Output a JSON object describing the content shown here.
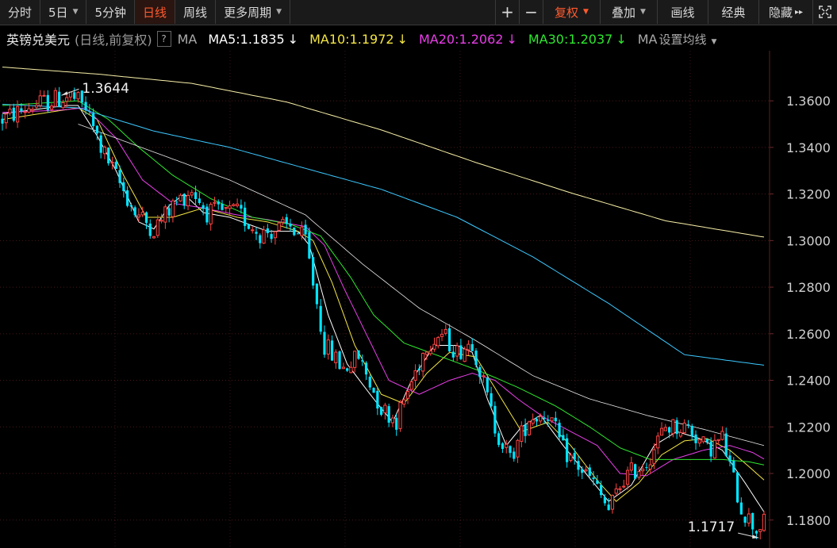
{
  "toolbar": {
    "tabs": [
      {
        "label": "分时",
        "dropdown": false,
        "active": false
      },
      {
        "label": "5日",
        "dropdown": true,
        "active": false
      },
      {
        "label": "5分钟",
        "dropdown": false,
        "active": false
      },
      {
        "label": "日线",
        "dropdown": false,
        "active": true
      },
      {
        "label": "周线",
        "dropdown": false,
        "active": false
      },
      {
        "label": "更多周期",
        "dropdown": true,
        "active": false
      }
    ],
    "zoom_in": "+",
    "zoom_out": "−",
    "fuquan": "复权",
    "diejia": "叠加",
    "huaxian": "画线",
    "jingdian": "经典",
    "yincang": "隐藏",
    "dropdown_glyph": "▼",
    "more_glyph": "▸▸"
  },
  "info": {
    "title": "英镑兑美元",
    "subtitle": "(日线,前复权)",
    "help": "?",
    "ma_label": "MA",
    "ma_items": [
      {
        "text": "MA5:1.1835",
        "arrow": "↓",
        "color": "#ffffff"
      },
      {
        "text": "MA10:1.1972",
        "arrow": "↓",
        "color": "#f5e642"
      },
      {
        "text": "MA20:1.2062",
        "arrow": "↓",
        "color": "#e83ee8"
      },
      {
        "text": "MA30:1.2037",
        "arrow": "↓",
        "color": "#2ee82e"
      }
    ],
    "ma_more": "MA",
    "settings": "设置均线"
  },
  "chart_data": {
    "type": "candlestick",
    "y_ticks": [
      "1.3600",
      "1.3400",
      "1.3200",
      "1.3000",
      "1.2800",
      "1.2600",
      "1.2400",
      "1.2200",
      "1.2000",
      "1.1800"
    ],
    "ylim": [
      1.168,
      1.3815
    ],
    "high_annotation": "1.3644",
    "low_annotation": "1.1717",
    "up_color": "#ff4444",
    "down_color": "#00e5ff",
    "anchors": [
      [
        0,
        1.352
      ],
      [
        8,
        1.358
      ],
      [
        18,
        1.362
      ],
      [
        22,
        1.357
      ],
      [
        26,
        1.34
      ],
      [
        35,
        1.312
      ],
      [
        40,
        1.305
      ],
      [
        45,
        1.315
      ],
      [
        50,
        1.322
      ],
      [
        54,
        1.312
      ],
      [
        62,
        1.312
      ],
      [
        68,
        1.303
      ],
      [
        76,
        1.306
      ],
      [
        80,
        1.3
      ],
      [
        85,
        1.255
      ],
      [
        90,
        1.245
      ],
      [
        94,
        1.25
      ],
      [
        100,
        1.228
      ],
      [
        104,
        1.223
      ],
      [
        112,
        1.256
      ],
      [
        116,
        1.26
      ],
      [
        120,
        1.252
      ],
      [
        124,
        1.257
      ],
      [
        130,
        1.22
      ],
      [
        134,
        1.206
      ],
      [
        139,
        1.224
      ],
      [
        144,
        1.226
      ],
      [
        148,
        1.21
      ],
      [
        156,
        1.196
      ],
      [
        160,
        1.184
      ],
      [
        164,
        1.198
      ],
      [
        170,
        1.205
      ],
      [
        175,
        1.22
      ],
      [
        181,
        1.22
      ],
      [
        186,
        1.21
      ],
      [
        190,
        1.215
      ],
      [
        195,
        1.185
      ],
      [
        199,
        1.176
      ],
      [
        201,
        1.18
      ]
    ],
    "ma_lines": [
      {
        "name": "MA5",
        "color": "#ffffff",
        "width": 1.0,
        "points": [
          [
            0,
            1.3545
          ],
          [
            17,
            1.358
          ],
          [
            20,
            1.358
          ],
          [
            25,
            1.345
          ],
          [
            30,
            1.33
          ],
          [
            36,
            1.308
          ],
          [
            40,
            1.305
          ],
          [
            44,
            1.315
          ],
          [
            48,
            1.32
          ],
          [
            53,
            1.312
          ],
          [
            60,
            1.31
          ],
          [
            70,
            1.304
          ],
          [
            78,
            1.304
          ],
          [
            81,
            1.298
          ],
          [
            86,
            1.268
          ],
          [
            91,
            1.247
          ],
          [
            98,
            1.232
          ],
          [
            103,
            1.222
          ],
          [
            108,
            1.24
          ],
          [
            114,
            1.255
          ],
          [
            120,
            1.255
          ],
          [
            124,
            1.252
          ],
          [
            128,
            1.232
          ],
          [
            133,
            1.212
          ],
          [
            137,
            1.22
          ],
          [
            142,
            1.225
          ],
          [
            148,
            1.212
          ],
          [
            154,
            1.2
          ],
          [
            160,
            1.188
          ],
          [
            166,
            1.195
          ],
          [
            172,
            1.212
          ],
          [
            178,
            1.218
          ],
          [
            184,
            1.215
          ],
          [
            190,
            1.21
          ],
          [
            196,
            1.196
          ],
          [
            201,
            1.1835
          ]
        ]
      },
      {
        "name": "MA10",
        "color": "#f5e642",
        "width": 1.0,
        "points": [
          [
            0,
            1.352
          ],
          [
            12,
            1.355
          ],
          [
            20,
            1.357
          ],
          [
            25,
            1.352
          ],
          [
            32,
            1.328
          ],
          [
            38,
            1.31
          ],
          [
            45,
            1.31
          ],
          [
            53,
            1.314
          ],
          [
            62,
            1.31
          ],
          [
            70,
            1.308
          ],
          [
            78,
            1.304
          ],
          [
            82,
            1.3
          ],
          [
            87,
            1.282
          ],
          [
            93,
            1.255
          ],
          [
            100,
            1.234
          ],
          [
            106,
            1.23
          ],
          [
            112,
            1.243
          ],
          [
            118,
            1.252
          ],
          [
            125,
            1.25
          ],
          [
            131,
            1.234
          ],
          [
            137,
            1.218
          ],
          [
            144,
            1.222
          ],
          [
            150,
            1.212
          ],
          [
            157,
            1.197
          ],
          [
            162,
            1.188
          ],
          [
            168,
            1.196
          ],
          [
            174,
            1.208
          ],
          [
            180,
            1.214
          ],
          [
            186,
            1.215
          ],
          [
            192,
            1.21
          ],
          [
            197,
            1.203
          ],
          [
            201,
            1.1972
          ]
        ]
      },
      {
        "name": "MA20",
        "color": "#e83ee8",
        "width": 1.0,
        "points": [
          [
            0,
            1.355
          ],
          [
            15,
            1.356
          ],
          [
            22,
            1.357
          ],
          [
            30,
            1.344
          ],
          [
            37,
            1.326
          ],
          [
            45,
            1.316
          ],
          [
            53,
            1.314
          ],
          [
            62,
            1.311
          ],
          [
            70,
            1.309
          ],
          [
            80,
            1.306
          ],
          [
            85,
            1.298
          ],
          [
            90,
            1.28
          ],
          [
            96,
            1.26
          ],
          [
            102,
            1.24
          ],
          [
            110,
            1.234
          ],
          [
            118,
            1.24
          ],
          [
            124,
            1.243
          ],
          [
            130,
            1.24
          ],
          [
            136,
            1.232
          ],
          [
            143,
            1.224
          ],
          [
            150,
            1.218
          ],
          [
            157,
            1.212
          ],
          [
            163,
            1.2
          ],
          [
            170,
            1.199
          ],
          [
            177,
            1.206
          ],
          [
            185,
            1.21
          ],
          [
            192,
            1.212
          ],
          [
            198,
            1.209
          ],
          [
            201,
            1.2062
          ]
        ]
      },
      {
        "name": "MA30",
        "color": "#2ee82e",
        "width": 1.0,
        "points": [
          [
            0,
            1.358
          ],
          [
            20,
            1.36
          ],
          [
            28,
            1.352
          ],
          [
            36,
            1.34
          ],
          [
            45,
            1.328
          ],
          [
            55,
            1.318
          ],
          [
            66,
            1.31
          ],
          [
            76,
            1.307
          ],
          [
            84,
            1.302
          ],
          [
            92,
            1.284
          ],
          [
            98,
            1.268
          ],
          [
            106,
            1.256
          ],
          [
            116,
            1.25
          ],
          [
            126,
            1.244
          ],
          [
            136,
            1.237
          ],
          [
            146,
            1.229
          ],
          [
            155,
            1.22
          ],
          [
            163,
            1.211
          ],
          [
            171,
            1.206
          ],
          [
            180,
            1.206
          ],
          [
            190,
            1.206
          ],
          [
            197,
            1.205
          ],
          [
            201,
            1.2037
          ]
        ]
      },
      {
        "name": "MA60",
        "color": "#e8e8e8",
        "width": 0.8,
        "points": [
          [
            20,
            1.35
          ],
          [
            40,
            1.338
          ],
          [
            60,
            1.326
          ],
          [
            80,
            1.311
          ],
          [
            95,
            1.29
          ],
          [
            110,
            1.271
          ],
          [
            125,
            1.257
          ],
          [
            140,
            1.242
          ],
          [
            155,
            1.232
          ],
          [
            170,
            1.225
          ],
          [
            185,
            1.219
          ],
          [
            201,
            1.212
          ]
        ]
      },
      {
        "name": "MA120",
        "color": "#3cc8ff",
        "width": 1.0,
        "points": [
          [
            0,
            1.3585
          ],
          [
            20,
            1.357
          ],
          [
            40,
            1.347
          ],
          [
            60,
            1.34
          ],
          [
            80,
            1.331
          ],
          [
            100,
            1.322
          ],
          [
            120,
            1.31
          ],
          [
            140,
            1.293
          ],
          [
            160,
            1.273
          ],
          [
            180,
            1.251
          ],
          [
            201,
            1.2465
          ]
        ]
      },
      {
        "name": "MA250",
        "color": "#f8f0a8",
        "width": 1.0,
        "points": [
          [
            0,
            1.3745
          ],
          [
            25,
            1.3715
          ],
          [
            50,
            1.3675
          ],
          [
            75,
            1.3595
          ],
          [
            100,
            1.3475
          ],
          [
            125,
            1.3335
          ],
          [
            150,
            1.3205
          ],
          [
            175,
            1.3085
          ],
          [
            201,
            1.3015
          ]
        ]
      }
    ]
  }
}
